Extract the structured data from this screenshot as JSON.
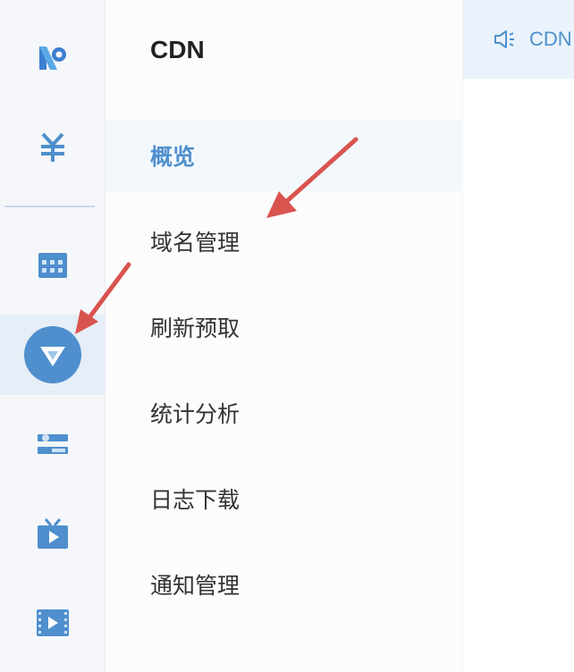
{
  "sidebar_icons": [
    {
      "name": "logo-icon",
      "active": false
    },
    {
      "name": "yuan-icon",
      "active": false
    },
    {
      "name": "grid-icon",
      "active": false
    },
    {
      "name": "cdn-icon",
      "active": true
    },
    {
      "name": "settings-sliders-icon",
      "active": false
    },
    {
      "name": "tv-icon",
      "active": false
    },
    {
      "name": "video-film-icon",
      "active": false
    }
  ],
  "submenu": {
    "title": "CDN",
    "items": [
      {
        "label": "概览",
        "active": true
      },
      {
        "label": "域名管理"
      },
      {
        "label": "刷新预取"
      },
      {
        "label": "统计分析"
      },
      {
        "label": "日志下载"
      },
      {
        "label": "通知管理"
      }
    ]
  },
  "notice": {
    "icon": "speaker-icon",
    "text": "CDN"
  },
  "colors": {
    "accent": "#4f8fcd",
    "annotation_arrow": "#d9534f",
    "active_bg": "#e6eef7"
  }
}
